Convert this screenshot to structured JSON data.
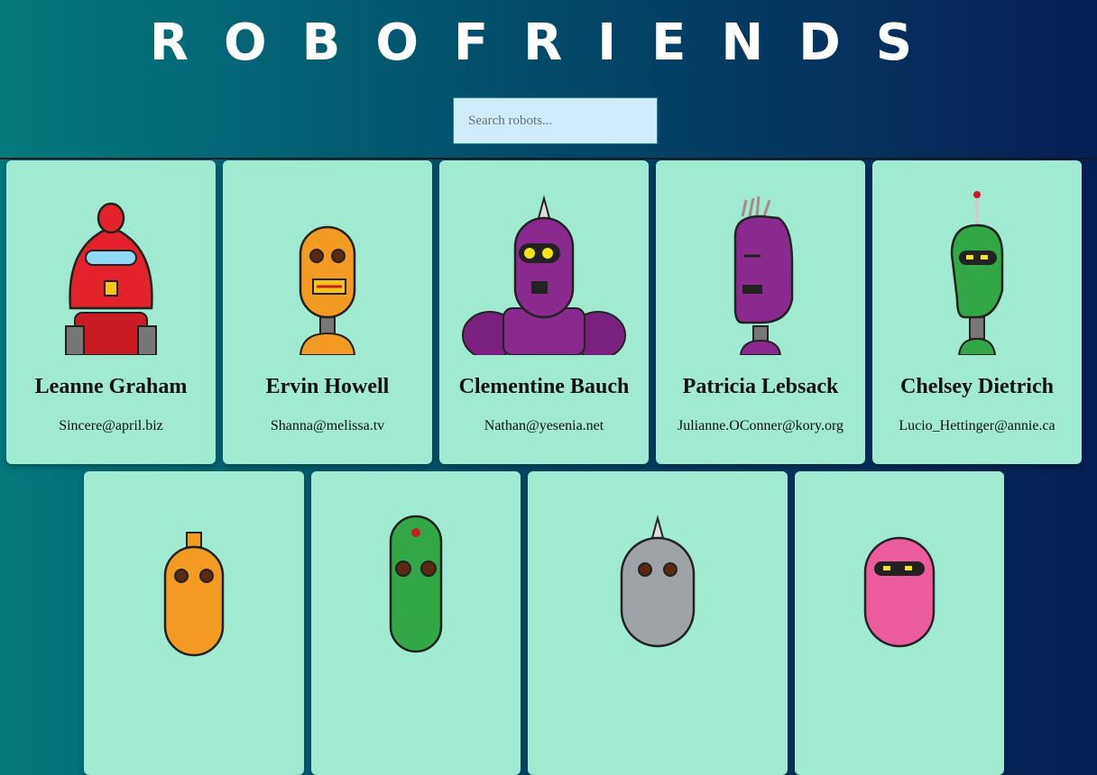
{
  "app": {
    "title": "ROBOFRIENDS",
    "search_placeholder": "Search robots..."
  },
  "robots": [
    {
      "name": "Leanne Graham",
      "email": "Sincere@april.biz",
      "color": "#e3222b"
    },
    {
      "name": "Ervin Howell",
      "email": "Shanna@melissa.tv",
      "color": "#f39a22"
    },
    {
      "name": "Clementine Bauch",
      "email": "Nathan@yesenia.net",
      "color": "#8b2a8e"
    },
    {
      "name": "Patricia Lebsack",
      "email": "Julianne.OConner@kory.org",
      "color": "#8b2a8e"
    },
    {
      "name": "Chelsey Dietrich",
      "email": "Lucio_Hettinger@annie.ca",
      "color": "#33a645"
    },
    {
      "name": "",
      "email": "",
      "color": "#f39a22"
    },
    {
      "name": "",
      "email": "",
      "color": "#33a645"
    },
    {
      "name": "",
      "email": "",
      "color": "#9ea3a8"
    },
    {
      "name": "",
      "email": "",
      "color": "#ec5b9c"
    }
  ]
}
